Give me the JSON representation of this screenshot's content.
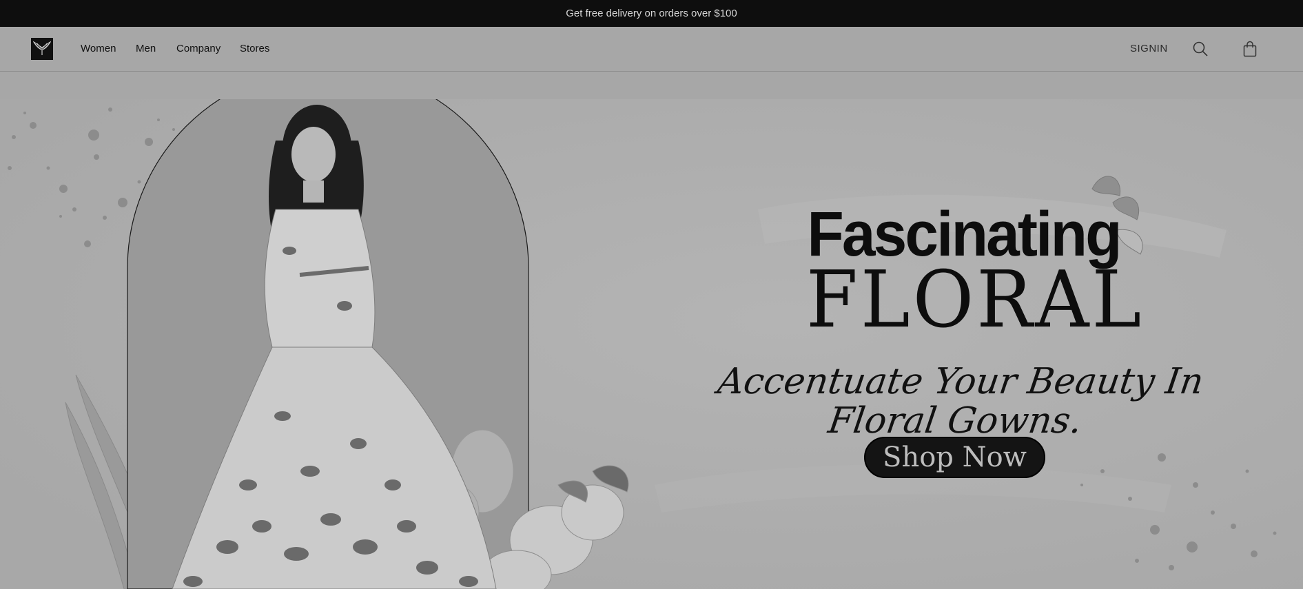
{
  "announcement": {
    "text": "Get free delivery on orders over $100"
  },
  "nav": {
    "links": [
      "Women",
      "Men",
      "Company",
      "Stores"
    ],
    "signin_label": "SIGNIN",
    "icons": {
      "logo": "eagle-logo-icon",
      "search": "search-icon",
      "bag": "shopping-bag-icon"
    }
  },
  "hero": {
    "title_line1": "Fascinating",
    "title_line2": "FLORAL",
    "subtitle": "Accentuate Your Beauty In Floral Gowns.",
    "cta_label": "Shop Now"
  },
  "colors": {
    "announcement_bg": "#0e0e0e",
    "page_bg": "#a7a7a7",
    "hero_bg": "#acacac",
    "arch_fill": "#999999",
    "cta_bg": "#141414",
    "text_dark": "#0d0d0d"
  }
}
